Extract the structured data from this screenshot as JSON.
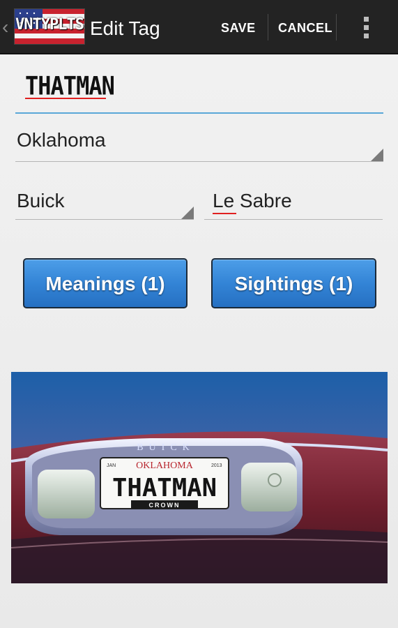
{
  "action_bar": {
    "up_icon": "chevron-left-icon",
    "logo_text": "VNTYPLTS",
    "title": "Edit Tag",
    "save_label": "SAVE",
    "cancel_label": "CANCEL",
    "overflow_icon": "vertical-ellipsis-icon",
    "background_color": "#232323"
  },
  "form": {
    "tag_value": "THATMAN",
    "state": "Oklahoma",
    "make": "Buick",
    "model": "Le Sabre",
    "accent_color": "#5aa7d8"
  },
  "buttons": {
    "meanings_label": "Meanings (1)",
    "sightings_label": "Sightings (1)",
    "button_color": "#3384d6"
  },
  "photo": {
    "plate_state": "OKLAHOMA",
    "plate_number": "THATMAN",
    "plate_frame_bottom": "CROWN",
    "trunk_badge": "BUICK",
    "plate_left_sticker": "JAN",
    "plate_right_sticker": "2013"
  }
}
